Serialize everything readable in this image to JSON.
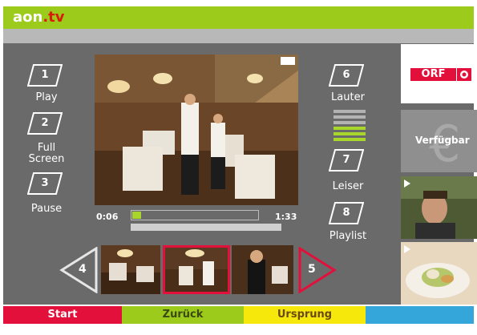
{
  "header": {
    "logo_main": "aon",
    "logo_tld": ".tv"
  },
  "controls": {
    "btn1": {
      "key": "1",
      "label": "Play"
    },
    "btn2": {
      "key": "2",
      "label_line1": "Full",
      "label_line2": "Screen"
    },
    "btn3": {
      "key": "3",
      "label": "Pause"
    },
    "btn6": {
      "key": "6",
      "label": "Lauter"
    },
    "btn7": {
      "key": "7",
      "label": "Leiser"
    },
    "btn8": {
      "key": "8",
      "label": "Playlist"
    },
    "prev_key": "4",
    "next_key": "5"
  },
  "player": {
    "current_time": "0:06",
    "total_time": "1:33",
    "progress_fraction": 0.068,
    "volume_bars_total": 6,
    "volume_bars_active": 3,
    "video_watermark": "ORF 2"
  },
  "channels": {
    "orf_logo": "ORF",
    "available_label": "Verfügbar"
  },
  "bottom_nav": {
    "start": "Start",
    "back": "Zurück",
    "origin": "Ursprung",
    "blue": ""
  },
  "colors": {
    "brand_green": "#9ccb1b",
    "red": "#e2103b",
    "yellow": "#f5e80a",
    "blue": "#35a6d9",
    "panel_gray": "#6a6a6a"
  }
}
